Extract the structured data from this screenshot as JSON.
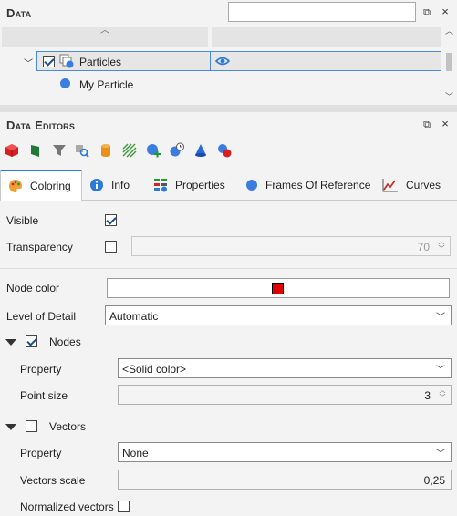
{
  "data_panel": {
    "title": "Data",
    "search_value": "",
    "tree": {
      "selected_item": "Particles",
      "child_item": "My Particle"
    }
  },
  "editors": {
    "title": "Data Editors",
    "toolbar_icons": [
      "red-cube-icon",
      "green-flag-icon",
      "filter-icon",
      "search-data-icon",
      "cylinder-icon",
      "hatch-icon",
      "add-sphere-icon",
      "clock-sphere-icon",
      "cone-icon",
      "multi-sphere-icon"
    ],
    "tabs": [
      {
        "label": "Coloring",
        "icon": "palette-icon",
        "active": true
      },
      {
        "label": "Info",
        "icon": "info-icon"
      },
      {
        "label": "Properties",
        "icon": "properties-icon"
      },
      {
        "label": "Frames Of Reference",
        "icon": "frames-icon"
      },
      {
        "label": "Curves",
        "icon": "curves-icon"
      }
    ],
    "coloring": {
      "visible_label": "Visible",
      "visible_checked": true,
      "transparency_label": "Transparency",
      "transparency_checked": false,
      "transparency_value": "70",
      "node_color_label": "Node color",
      "node_color": "#e00000",
      "lod_label": "Level of Detail",
      "lod_value": "Automatic",
      "nodes_label": "Nodes",
      "nodes_checked": true,
      "nodes_property_label": "Property",
      "nodes_property_value": "<Solid color>",
      "point_size_label": "Point size",
      "point_size_value": "3",
      "vectors_label": "Vectors",
      "vectors_checked": false,
      "vectors_property_label": "Property",
      "vectors_property_value": "None",
      "vectors_scale_label": "Vectors scale",
      "vectors_scale_value": "0,25",
      "normalized_label": "Normalized vectors",
      "normalized_checked": false
    }
  },
  "colors": {
    "accent": "#2a7ad6",
    "selection_border": "#4a8ad6"
  }
}
